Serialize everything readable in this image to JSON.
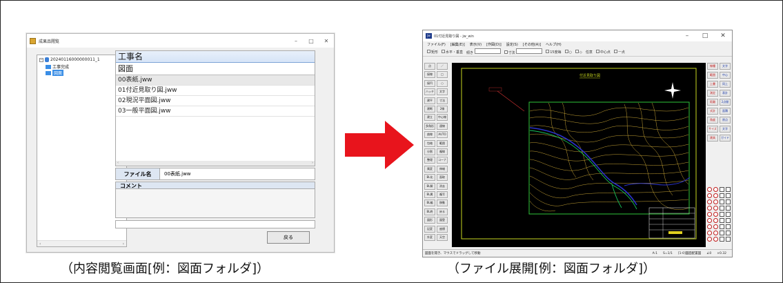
{
  "left_window": {
    "title": "成果品閲覧",
    "tree": {
      "root": "20240116000000011_1",
      "child1": "工事完成",
      "child2": "図面"
    },
    "list": {
      "header1": "工事名",
      "header2": "図面",
      "files": [
        "00表紙.jww",
        "01付近見取り図.jww",
        "02現況平面図.jww",
        "03一般平面図.jww"
      ]
    },
    "filename_label": "ファイル名",
    "filename_value": "00表紙.jww",
    "comment_label": "コメント",
    "back_button": "戻る"
  },
  "right_window": {
    "title": "01付近見取り図 - jw_win",
    "menu": [
      "ファイル(F)",
      "[編集(E)]",
      "表示(V)",
      "[作図(D)]",
      "設定(S)",
      "[その他(A)]",
      "ヘルプ(H)"
    ],
    "toolbar": [
      "矩形",
      "水平・垂直",
      "傾き",
      "寸法",
      "15度毎",
      "○",
      "◇",
      "任意",
      "中心点",
      "ー点"
    ],
    "left_tools": [
      "点",
      "／",
      "接線",
      "□",
      "接円",
      "○",
      "ハッチ",
      "文字",
      "建平",
      "寸法",
      "建断",
      "2線",
      "建立",
      "中心線",
      "多角形",
      "連線",
      "曲線",
      "AUTO",
      "包絡",
      "範囲",
      "分割",
      "複線",
      "整理",
      "コーナー",
      "属変",
      "伸縮",
      "BL化",
      "面取",
      "BL解",
      "消去",
      "BL属",
      "複写",
      "BL編",
      "移動",
      "BL終",
      "戻る",
      "図形",
      "図登",
      "記変",
      "座標",
      "外変",
      "天空"
    ],
    "right_tools": [
      "線種",
      "文字",
      "範囲",
      "中心",
      "上書",
      "同上",
      "測定",
      "表計",
      "距離",
      "2点間",
      "式計",
      "面積",
      "角度",
      "原点",
      "サイズ",
      "文字",
      "建具",
      "ガイド"
    ],
    "drawing_title": "付近見取り図",
    "status": [
      "図面を開き、マウスでドラッグして移動",
      "A-1",
      "S=1/1",
      "[1-0]図面配置図",
      "∠0",
      "×0.32"
    ]
  },
  "captions": {
    "left": "（内容閲覧画面[例：図面フォルダ]）",
    "right": "（ファイル展開[例：図面フォルダ]）"
  },
  "colors": {
    "arrow": "#e8141c",
    "canvas_bg": "#000000",
    "contour": "#d8b23a",
    "river": "#2a33c9",
    "road": "#17c45a",
    "frame_line": "#c9d81f"
  }
}
